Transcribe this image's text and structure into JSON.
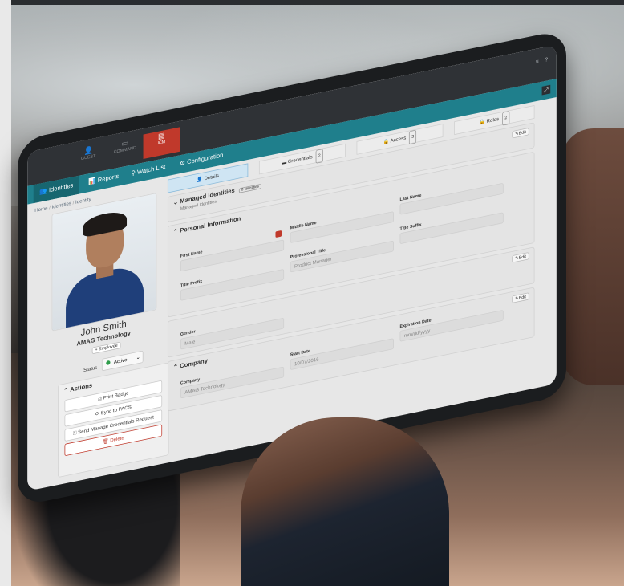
{
  "app": {
    "switcher": [
      {
        "label": "GUEST",
        "icon": "user-icon"
      },
      {
        "label": "COMMAND",
        "icon": "monitor-icon"
      },
      {
        "label": "ICM",
        "icon": "id-card-icon"
      }
    ],
    "tools": [
      "≡",
      "?"
    ],
    "nav_tabs": [
      "Identities",
      "Reports",
      "Watch List",
      "Configuration"
    ],
    "active_nav": "Identities"
  },
  "breadcrumb": [
    "Home",
    "Identities",
    "Identity"
  ],
  "profile": {
    "name": "John Smith",
    "company": "AMAG Technology",
    "role_badge": "+ Employee",
    "status_label": "Status",
    "status_value": "Active"
  },
  "actions": {
    "title": "Actions",
    "buttons": [
      "Print Badge",
      "Sync to PACS",
      "Send Manage Credentials Request",
      "Delete"
    ]
  },
  "detail_tabs": [
    {
      "label": "Details",
      "count": null
    },
    {
      "label": "Credentials",
      "count": "2"
    },
    {
      "label": "Access",
      "count": "3"
    },
    {
      "label": "Roles",
      "count": "2"
    }
  ],
  "managed": {
    "title": "Managed Identities",
    "pill": "0 Identities",
    "subtitle": "Managed Identities",
    "edit": "Edit"
  },
  "personal": {
    "title": "Personal Information",
    "edit": "Edit",
    "fields": {
      "first_name": {
        "label": "First Name",
        "value": ""
      },
      "middle_name": {
        "label": "Middle Name",
        "value": ""
      },
      "last_name": {
        "label": "Last Name",
        "value": ""
      },
      "title_prefix": {
        "label": "Title Prefix",
        "value": ""
      },
      "professional_title": {
        "label": "Professional Title",
        "value": "Product Manager"
      },
      "title_suffix": {
        "label": "Title Suffix",
        "value": ""
      },
      "gender": {
        "label": "Gender",
        "value": "Male"
      }
    }
  },
  "company_section": {
    "title": "Company",
    "edit": "Edit",
    "fields": {
      "company": {
        "label": "Company",
        "value": "AMAG Technology"
      },
      "start_date": {
        "label": "Start Date",
        "value": "10/07/2016"
      },
      "expiration_date": {
        "label": "Expiration Date",
        "value": "mm/dd/yyyy"
      }
    }
  },
  "colors": {
    "nav": "#1f7f8c",
    "appbar": "#2f3236",
    "accent_red": "#c0392b",
    "active_green": "#2e9c4a"
  }
}
